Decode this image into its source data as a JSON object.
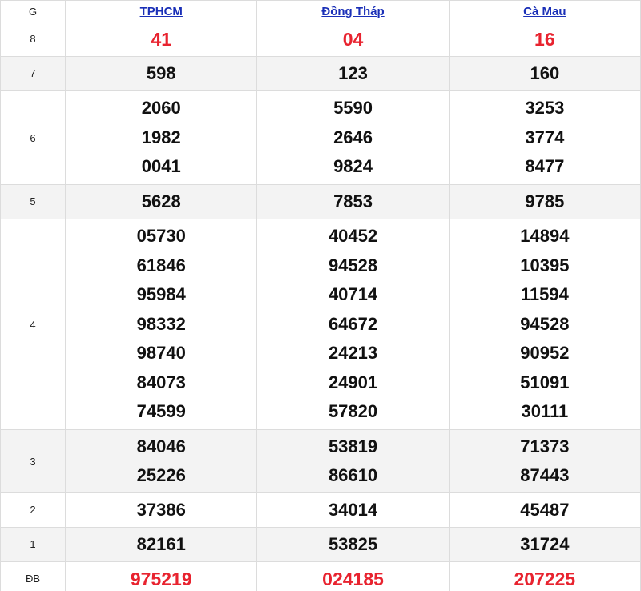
{
  "header": {
    "g_label": "G",
    "provinces": [
      "TPHCM",
      "Đồng Tháp",
      "Cà Mau"
    ]
  },
  "prizes": [
    {
      "label": "8",
      "values": [
        [
          "41"
        ],
        [
          "04"
        ],
        [
          "16"
        ]
      ],
      "highlight": true
    },
    {
      "label": "7",
      "values": [
        [
          "598"
        ],
        [
          "123"
        ],
        [
          "160"
        ]
      ],
      "highlight": false
    },
    {
      "label": "6",
      "values": [
        [
          "2060",
          "1982",
          "0041"
        ],
        [
          "5590",
          "2646",
          "9824"
        ],
        [
          "3253",
          "3774",
          "8477"
        ]
      ],
      "highlight": false
    },
    {
      "label": "5",
      "values": [
        [
          "5628"
        ],
        [
          "7853"
        ],
        [
          "9785"
        ]
      ],
      "highlight": false
    },
    {
      "label": "4",
      "values": [
        [
          "05730",
          "61846",
          "95984",
          "98332",
          "98740",
          "84073",
          "74599"
        ],
        [
          "40452",
          "94528",
          "40714",
          "64672",
          "24213",
          "24901",
          "57820"
        ],
        [
          "14894",
          "10395",
          "11594",
          "94528",
          "90952",
          "51091",
          "30111"
        ]
      ],
      "highlight": false
    },
    {
      "label": "3",
      "values": [
        [
          "84046",
          "25226"
        ],
        [
          "53819",
          "86610"
        ],
        [
          "71373",
          "87443"
        ]
      ],
      "highlight": false
    },
    {
      "label": "2",
      "values": [
        [
          "37386"
        ],
        [
          "34014"
        ],
        [
          "45487"
        ]
      ],
      "highlight": false
    },
    {
      "label": "1",
      "values": [
        [
          "82161"
        ],
        [
          "53825"
        ],
        [
          "31724"
        ]
      ],
      "highlight": false
    },
    {
      "label": "ĐB",
      "values": [
        [
          "975219"
        ],
        [
          "024185"
        ],
        [
          "207225"
        ]
      ],
      "highlight": true
    }
  ],
  "colors": {
    "link": "#1a2fb7",
    "special_number": "#e8232f",
    "alt_row_bg": "#f3f3f3"
  }
}
